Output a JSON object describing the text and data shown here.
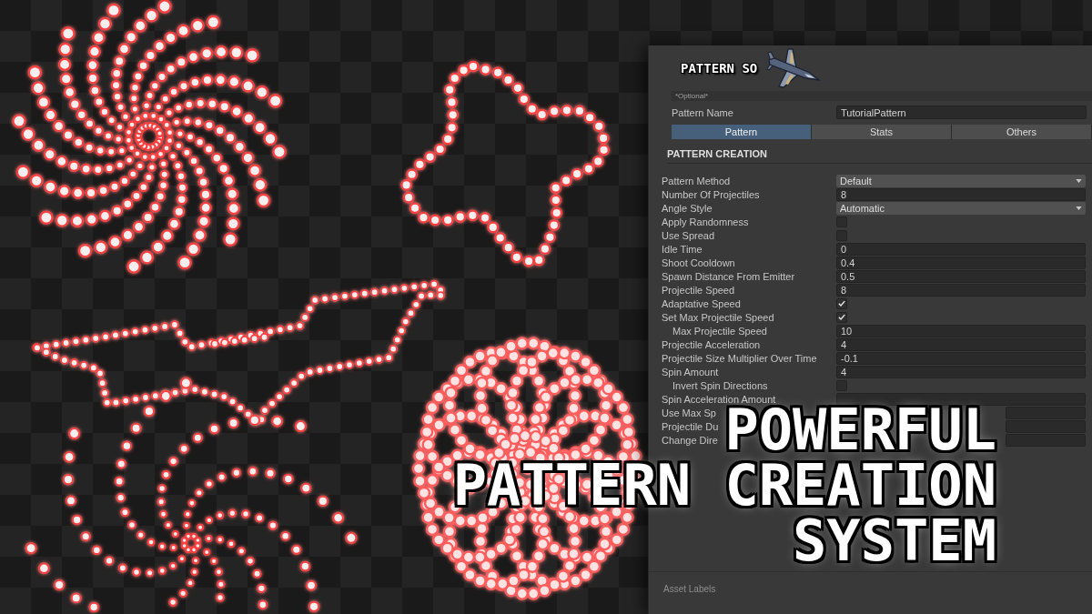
{
  "inspector": {
    "title": "PATTERN SO",
    "optional_note": "*Optional*",
    "pattern_name": {
      "label": "Pattern Name",
      "value": "TutorialPattern"
    },
    "tabs": [
      {
        "label": "Pattern",
        "selected": true
      },
      {
        "label": "Stats",
        "selected": false
      },
      {
        "label": "Others",
        "selected": false
      }
    ],
    "section_title": "PATTERN CREATION",
    "fields": [
      {
        "label": "Pattern Method",
        "kind": "dropdown",
        "value": "Default"
      },
      {
        "label": "Number Of Projectiles",
        "kind": "number",
        "value": "8"
      },
      {
        "label": "Angle Style",
        "kind": "dropdown",
        "value": "Automatic"
      },
      {
        "label": "Apply Randomness",
        "kind": "checkbox",
        "checked": false
      },
      {
        "label": "Use Spread",
        "kind": "checkbox",
        "checked": false
      },
      {
        "label": "Idle Time",
        "kind": "number",
        "value": "0"
      },
      {
        "label": "Shoot Cooldown",
        "kind": "number",
        "value": "0.4"
      },
      {
        "label": "Spawn Distance From Emitter",
        "kind": "number",
        "value": "0.5"
      },
      {
        "label": "Projectile Speed",
        "kind": "number",
        "value": "8"
      },
      {
        "label": "Adaptative Speed",
        "kind": "checkbox",
        "checked": true
      },
      {
        "label": "Set Max Projectile Speed",
        "kind": "checkbox",
        "checked": true,
        "children": [
          {
            "label": "Max Projectile Speed",
            "kind": "number",
            "value": "10"
          }
        ]
      },
      {
        "label": "Projectile Acceleration",
        "kind": "number",
        "value": "4"
      },
      {
        "label": "Projectile Size Multiplier Over Time",
        "kind": "number",
        "value": "-0.1"
      },
      {
        "label": "Spin Amount",
        "kind": "number",
        "value": "4",
        "children": [
          {
            "label": "Invert Spin Directions",
            "kind": "checkbox",
            "checked": false
          }
        ]
      },
      {
        "label": "Spin Acceleration Amount",
        "kind": "number"
      },
      {
        "label": "Use Max Sp",
        "kind": "number"
      },
      {
        "label": "Projectile Du",
        "kind": "number"
      },
      {
        "label": "Change Dire",
        "kind": "number"
      }
    ],
    "footer_label": "Asset Labels"
  },
  "headline": [
    "POWERFUL",
    "PATTERN CREATION",
    "SYSTEM"
  ]
}
